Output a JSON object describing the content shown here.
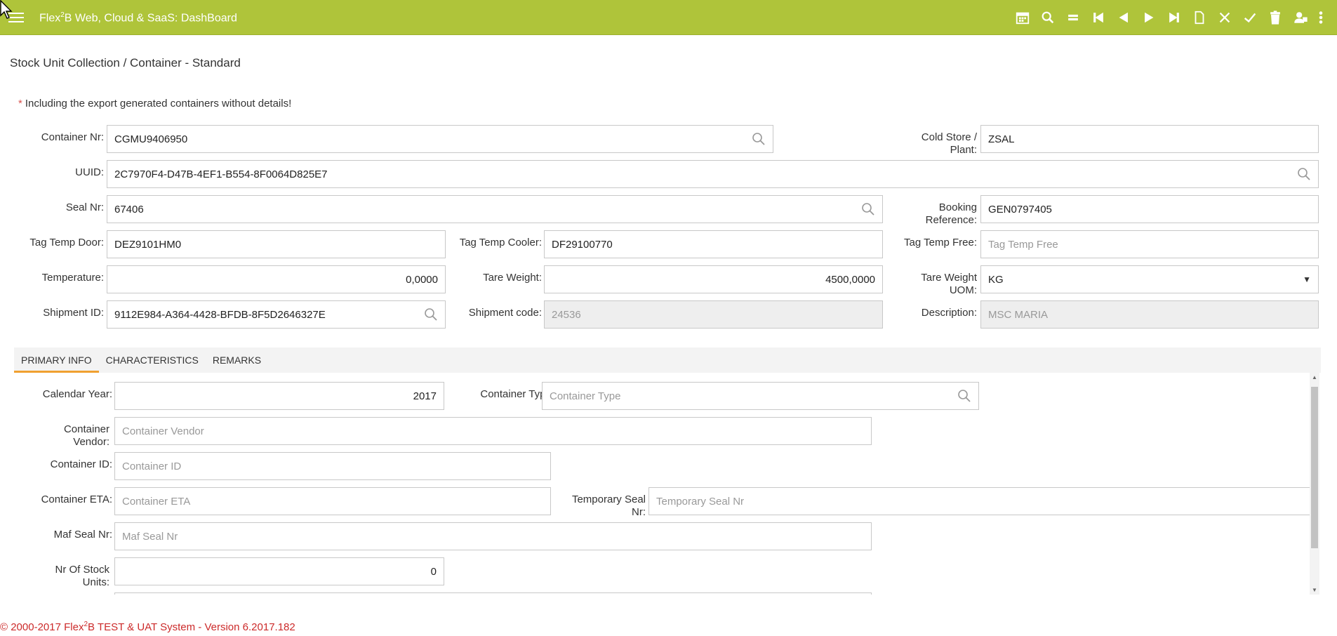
{
  "header": {
    "title_prefix": "Flex",
    "title_sup": "2",
    "title_suffix": "B Web, Cloud & SaaS: DashBoard",
    "toolbar": [
      "calendar-icon",
      "search-icon",
      "equals-icon",
      "first-icon",
      "previous-icon",
      "next-icon",
      "last-icon",
      "new-document-icon",
      "cancel-icon",
      "confirm-icon",
      "delete-icon",
      "user-icon",
      "more-icon"
    ]
  },
  "page": {
    "title": "Stock Unit Collection / Container - Standard",
    "note_star": "*",
    "note_text": "Including the export generated containers without details!"
  },
  "form": {
    "container_nr": {
      "label": "Container Nr:",
      "value": "CGMU9406950"
    },
    "cold_store": {
      "label1": "Cold Store /",
      "label2": "Plant:",
      "value": "ZSAL"
    },
    "uuid": {
      "label": "UUID:",
      "value": "2C7970F4-D47B-4EF1-B554-8F0064D825E7"
    },
    "seal_nr": {
      "label": "Seal Nr:",
      "value": "67406"
    },
    "booking_reference": {
      "label1": "Booking",
      "label2": "Reference:",
      "value": "GEN0797405"
    },
    "tag_temp_door": {
      "label": "Tag Temp Door:",
      "value": "DEZ9101HM0"
    },
    "tag_temp_cooler": {
      "label": "Tag Temp Cooler:",
      "value": "DF29100770"
    },
    "tag_temp_free": {
      "label": "Tag Temp Free:",
      "placeholder": "Tag Temp Free"
    },
    "temperature": {
      "label": "Temperature:",
      "value": "0,0000"
    },
    "tare_weight": {
      "label": "Tare Weight:",
      "value": "4500,0000"
    },
    "tare_weight_uom": {
      "label1": "Tare Weight",
      "label2": "UOM:",
      "value": "KG"
    },
    "shipment_id": {
      "label": "Shipment ID:",
      "value": "9112E984-A364-4428-BFDB-8F5D2646327E"
    },
    "shipment_code": {
      "label": "Shipment code:",
      "value": "24536"
    },
    "description": {
      "label": "Description:",
      "value": "MSC MARIA"
    }
  },
  "tabs": [
    {
      "label": "PRIMARY INFO",
      "active": true
    },
    {
      "label": "CHARACTERISTICS",
      "active": false
    },
    {
      "label": "REMARKS",
      "active": false
    }
  ],
  "primary": {
    "calendar_year": {
      "label": "Calendar Year:",
      "value": "2017"
    },
    "container_type": {
      "label": "Container Type:",
      "placeholder": "Container Type"
    },
    "container_vendor": {
      "label1": "Container",
      "label2": "Vendor:",
      "placeholder": "Container Vendor"
    },
    "container_id": {
      "label": "Container ID:",
      "placeholder": "Container ID"
    },
    "container_eta": {
      "label": "Container ETA:",
      "placeholder": "Container ETA"
    },
    "temporary_seal": {
      "label1": "Temporary Seal",
      "label2": "Nr:",
      "placeholder": "Temporary Seal Nr"
    },
    "maf_seal": {
      "label": "Maf Seal Nr:",
      "placeholder": "Maf Seal Nr"
    },
    "nr_stock_units": {
      "label1": "Nr Of Stock",
      "label2": "Units:",
      "value": "0"
    }
  },
  "footer": {
    "prefix": "© 2000-2017 Flex",
    "sup": "2",
    "suffix": "B TEST & UAT System - Version 6.2017.182"
  },
  "colors": {
    "header": "#afc43a",
    "tab_accent": "#f0a030",
    "footer_text": "#cc2a2a"
  }
}
